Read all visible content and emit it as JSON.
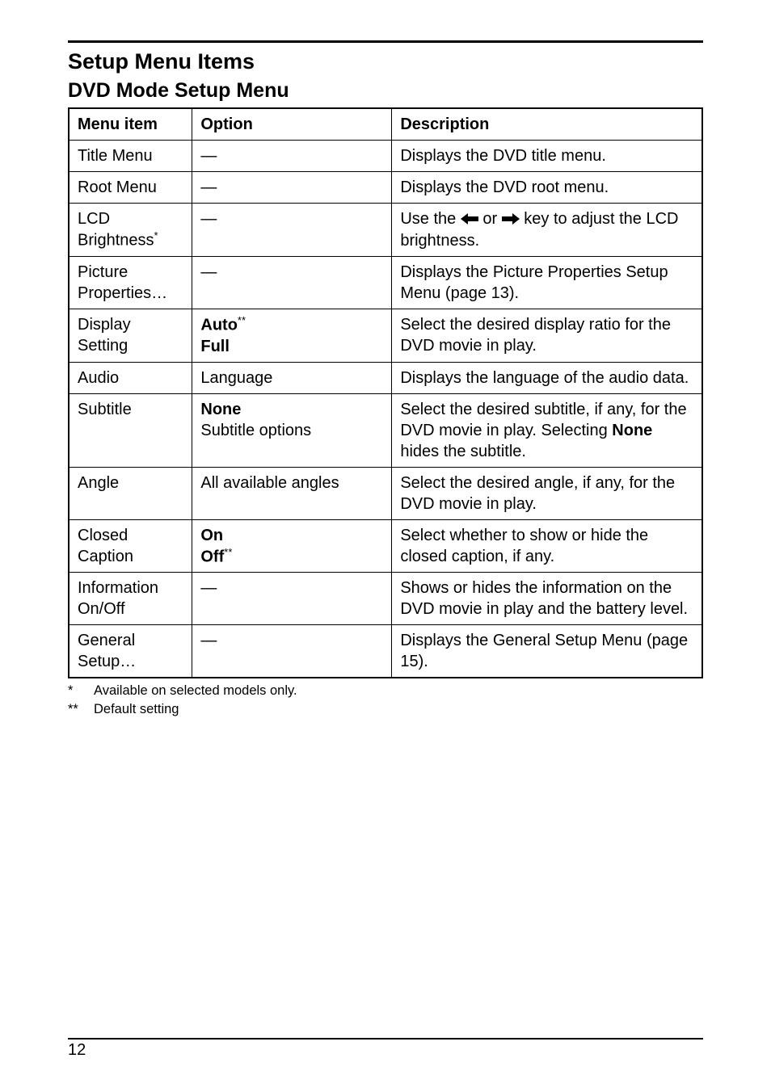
{
  "headings": {
    "h1": "Setup Menu Items",
    "h2": "DVD Mode Setup Menu"
  },
  "table": {
    "headers": {
      "menu_item": "Menu item",
      "option": "Option",
      "description": "Description"
    },
    "rows": [
      {
        "menu_item_parts": [
          {
            "text": "Title Menu"
          }
        ],
        "option_parts": [
          {
            "text": "—"
          }
        ],
        "desc_parts": [
          {
            "text": "Displays the DVD title menu."
          }
        ]
      },
      {
        "menu_item_parts": [
          {
            "text": "Root Menu"
          }
        ],
        "option_parts": [
          {
            "text": "—"
          }
        ],
        "desc_parts": [
          {
            "text": "Displays the DVD root menu."
          }
        ]
      },
      {
        "menu_item_parts": [
          {
            "text": "LCD Brightness"
          },
          {
            "text": "*",
            "sup": true
          }
        ],
        "option_parts": [
          {
            "text": "—"
          }
        ],
        "desc_parts": [
          {
            "text": "Use the "
          },
          {
            "arrow": "left"
          },
          {
            "text": " or "
          },
          {
            "arrow": "right"
          },
          {
            "text": " key to adjust the LCD brightness."
          }
        ]
      },
      {
        "menu_item_parts": [
          {
            "text": "Picture Properties…"
          }
        ],
        "option_parts": [
          {
            "text": "—"
          }
        ],
        "desc_parts": [
          {
            "text": "Displays the Picture Properties Setup Menu (page 13)."
          }
        ]
      },
      {
        "menu_item_parts": [
          {
            "text": "Display Setting"
          }
        ],
        "option_parts": [
          {
            "text": "Auto",
            "bold": true
          },
          {
            "text": "**",
            "sup": true
          },
          {
            "br": true
          },
          {
            "text": "Full",
            "bold": true
          }
        ],
        "desc_parts": [
          {
            "text": "Select the desired display ratio for the DVD movie in play."
          }
        ]
      },
      {
        "menu_item_parts": [
          {
            "text": "Audio"
          }
        ],
        "option_parts": [
          {
            "text": "Language"
          }
        ],
        "desc_parts": [
          {
            "text": "Displays the language of the audio data."
          }
        ]
      },
      {
        "menu_item_parts": [
          {
            "text": "Subtitle"
          }
        ],
        "option_parts": [
          {
            "text": "None",
            "bold": true
          },
          {
            "br": true
          },
          {
            "text": "Subtitle options"
          }
        ],
        "desc_parts": [
          {
            "text": "Select the desired subtitle, if any, for the DVD movie in play. Selecting "
          },
          {
            "text": "None",
            "bold": true
          },
          {
            "text": " hides the subtitle."
          }
        ]
      },
      {
        "menu_item_parts": [
          {
            "text": "Angle"
          }
        ],
        "option_parts": [
          {
            "text": "All available angles"
          }
        ],
        "desc_parts": [
          {
            "text": "Select the desired angle, if any, for the DVD movie in play."
          }
        ]
      },
      {
        "menu_item_parts": [
          {
            "text": "Closed Caption"
          }
        ],
        "option_parts": [
          {
            "text": "On",
            "bold": true
          },
          {
            "br": true
          },
          {
            "text": "Off",
            "bold": true
          },
          {
            "text": "**",
            "sup": true
          }
        ],
        "desc_parts": [
          {
            "text": "Select whether to show or hide the closed caption, if any."
          }
        ]
      },
      {
        "menu_item_parts": [
          {
            "text": "Information On/Off"
          }
        ],
        "option_parts": [
          {
            "text": "—"
          }
        ],
        "desc_parts": [
          {
            "text": "Shows or hides the information on the DVD movie in play and the battery level."
          }
        ]
      },
      {
        "menu_item_parts": [
          {
            "text": "General Setup…"
          }
        ],
        "option_parts": [
          {
            "text": "—"
          }
        ],
        "desc_parts": [
          {
            "text": "Displays the General Setup Menu (page 15)."
          }
        ]
      }
    ]
  },
  "footnotes": [
    {
      "mark": "*",
      "text": "Available on selected models only."
    },
    {
      "mark": "**",
      "text": "Default setting"
    }
  ],
  "page_number": "12"
}
